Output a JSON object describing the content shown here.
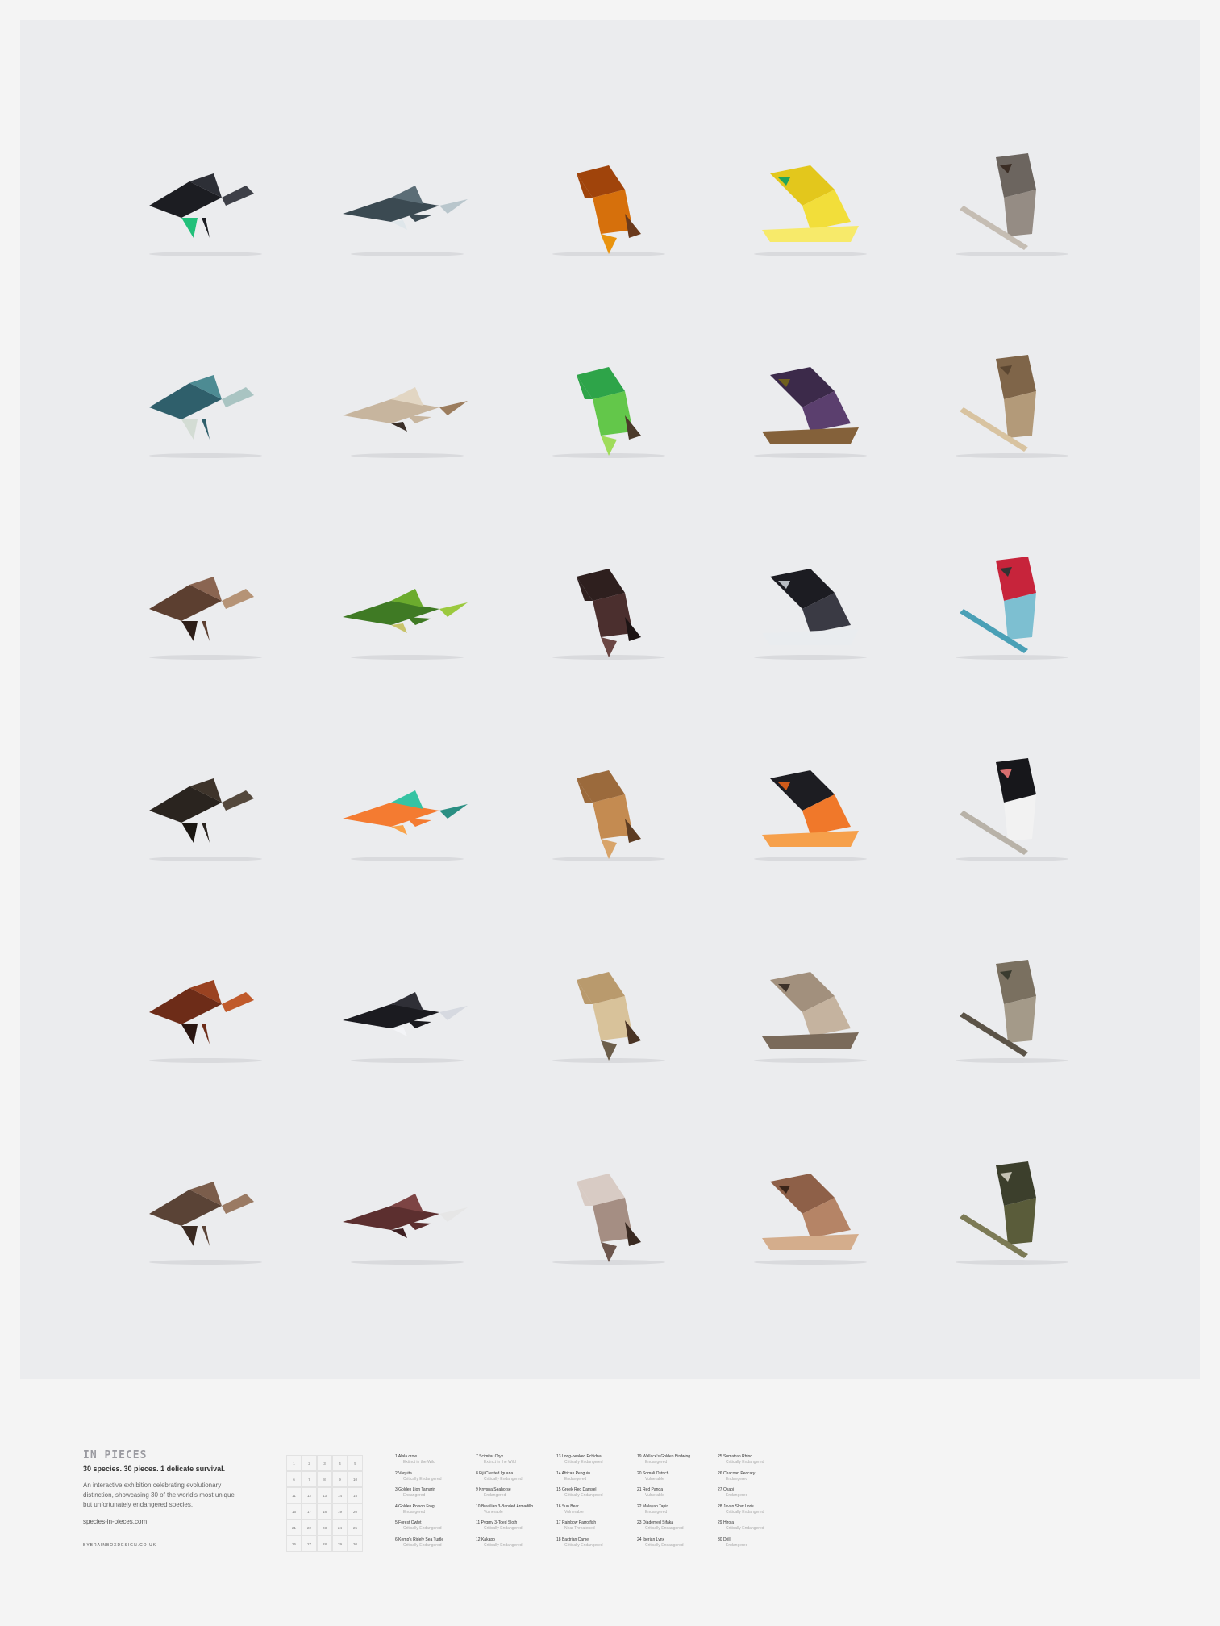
{
  "colors": {
    "canvas": "#ebecee",
    "page": "#f4f4f4",
    "accent": "#9a9aa0"
  },
  "animals": [
    {
      "icon": "crow-icon",
      "colors": [
        "#1c1d22",
        "#2d2f36",
        "#3e4048",
        "#22c07a"
      ]
    },
    {
      "icon": "vaquita-icon",
      "colors": [
        "#3b4a52",
        "#5b6d76",
        "#b9c6cc",
        "#dfe6ea"
      ]
    },
    {
      "icon": "golden-lion-tamarin-icon",
      "colors": [
        "#a0440b",
        "#d6700c",
        "#e9930e",
        "#6b3a1c"
      ]
    },
    {
      "icon": "golden-poison-frog-icon",
      "colors": [
        "#e3c71c",
        "#f2de3a",
        "#f7ea6a",
        "#23a45b"
      ]
    },
    {
      "icon": "forest-owlet-icon",
      "colors": [
        "#6c655f",
        "#958c84",
        "#c5bdb3",
        "#3b2d24"
      ]
    },
    {
      "icon": "kemps-ridley-sea-turtle-icon",
      "colors": [
        "#2f5f6b",
        "#4d8b93",
        "#a9c4c2",
        "#d3dcd4"
      ]
    },
    {
      "icon": "addax-icon",
      "colors": [
        "#c7b59e",
        "#e2d6c3",
        "#9c7d5e",
        "#3a2f29"
      ]
    },
    {
      "icon": "fiji-crested-iguana-icon",
      "colors": [
        "#2ea449",
        "#63c74a",
        "#9fdc5a",
        "#4b3a2a"
      ]
    },
    {
      "icon": "knysna-seahorse-icon",
      "colors": [
        "#3c2a4a",
        "#5b3f6e",
        "#84613a",
        "#6f5f1e"
      ]
    },
    {
      "icon": "brazilian-3-banded-armadillo-icon",
      "colors": [
        "#7f6549",
        "#b39a79",
        "#d8c3a0",
        "#5b4631"
      ]
    },
    {
      "icon": "pygmy-3-toed-sloth-icon",
      "colors": [
        "#5c3f30",
        "#8a6551",
        "#b59376",
        "#2d1e18"
      ]
    },
    {
      "icon": "kakapo-icon",
      "colors": [
        "#3f7a24",
        "#6bab2d",
        "#9bc93e",
        "#c8c36a"
      ]
    },
    {
      "icon": "long-beaked-echidna-icon",
      "colors": [
        "#2e1f1e",
        "#4b2f2e",
        "#6b4744",
        "#1d1414"
      ]
    },
    {
      "icon": "african-penguin-icon",
      "colors": [
        "#1c1c22",
        "#3a3a44",
        "#e9ecef",
        "#b8bcc2"
      ]
    },
    {
      "icon": "greek-red-damsel-icon",
      "colors": [
        "#c7243b",
        "#7dbfd1",
        "#4aa0b6",
        "#333"
      ]
    },
    {
      "icon": "sun-bear-icon",
      "colors": [
        "#2a241f",
        "#3e342b",
        "#54483c",
        "#1a1612"
      ]
    },
    {
      "icon": "rainbow-parrotfish-icon",
      "colors": [
        "#f47b31",
        "#35c3a3",
        "#2a8f83",
        "#f9a34a"
      ]
    },
    {
      "icon": "bactrian-camel-icon",
      "colors": [
        "#9b6a3c",
        "#c48b51",
        "#d8a46a",
        "#5d3c22"
      ]
    },
    {
      "icon": "wallaces-golden-birdwing-icon",
      "colors": [
        "#1d1d22",
        "#f0782a",
        "#f6a04b",
        "#cf5b1a"
      ]
    },
    {
      "icon": "somali-ostrich-icon",
      "colors": [
        "#17171b",
        "#f2f2f2",
        "#b8b2a8",
        "#d86f6f"
      ]
    },
    {
      "icon": "red-panda-icon",
      "colors": [
        "#6d2c18",
        "#9a4221",
        "#c05a2b",
        "#2a1611"
      ]
    },
    {
      "icon": "malayan-tapir-icon",
      "colors": [
        "#1b1b20",
        "#2f2f36",
        "#d6d9e0",
        "#f3f4f7"
      ]
    },
    {
      "icon": "diademed-sifaka-icon",
      "colors": [
        "#b99a6d",
        "#d8c29a",
        "#6c5e4b",
        "#4a3425"
      ]
    },
    {
      "icon": "iberian-lynx-icon",
      "colors": [
        "#a2907d",
        "#c5b39f",
        "#7a6a5a",
        "#3d322a"
      ]
    },
    {
      "icon": "sumatran-rhino-icon",
      "colors": [
        "#7a7060",
        "#a49a89",
        "#5b5347",
        "#3a3b2f"
      ]
    },
    {
      "icon": "chacoan-peccary-icon",
      "colors": [
        "#5a4336",
        "#7b5d4b",
        "#9a7a63",
        "#3a2a22"
      ]
    },
    {
      "icon": "okapi-icon",
      "colors": [
        "#5c2f2f",
        "#7d4444",
        "#e6e6e6",
        "#3d1f21"
      ]
    },
    {
      "icon": "javan-slow-loris-icon",
      "colors": [
        "#d8cbc4",
        "#a58e83",
        "#6d574e",
        "#3a2a22"
      ]
    },
    {
      "icon": "hirola-icon",
      "colors": [
        "#8e6048",
        "#b58466",
        "#d4ad8c",
        "#3a2419"
      ]
    },
    {
      "icon": "drill-icon",
      "colors": [
        "#3c3f2c",
        "#5a5c3a",
        "#7c7a55",
        "#c5c3b5"
      ]
    }
  ],
  "footer": {
    "title": "IN PIECES",
    "tagline": "30 species. 30 pieces. 1 delicate survival.",
    "description": "An interactive exhibition celebrating evolutionary distinction, showcasing 30 of the world's most unique but unfortunately endangered species.",
    "url": "species-in-pieces.com",
    "credit": "BYBRAINBOXDESIGN.CO.UK",
    "numbers": [
      "1",
      "2",
      "3",
      "4",
      "5",
      "6",
      "7",
      "8",
      "9",
      "10",
      "11",
      "12",
      "13",
      "14",
      "15",
      "16",
      "17",
      "18",
      "19",
      "20",
      "21",
      "22",
      "23",
      "24",
      "25",
      "26",
      "27",
      "28",
      "29",
      "30"
    ],
    "species": [
      {
        "num": "1",
        "name": "Alala crow",
        "status": "Extinct in the Wild"
      },
      {
        "num": "2",
        "name": "Vaquita",
        "status": "Critically Endangered"
      },
      {
        "num": "3",
        "name": "Golden Lion Tamarin",
        "status": "Endangered"
      },
      {
        "num": "4",
        "name": "Golden Poison Frog",
        "status": "Endangered"
      },
      {
        "num": "5",
        "name": "Forest Owlet",
        "status": "Critically Endangered"
      },
      {
        "num": "6",
        "name": "Kemp's Ridely Sea Turtle",
        "status": "Critically Endangered"
      },
      {
        "num": "7",
        "name": "Scimitar Oryx",
        "status": "Extinct in the Wild"
      },
      {
        "num": "8",
        "name": "Fiji Crested Iguana",
        "status": "Critically Endangered"
      },
      {
        "num": "9",
        "name": "Knysna Seahorse",
        "status": "Endangered"
      },
      {
        "num": "10",
        "name": "Brazilian 3-Banded Armadillo",
        "status": "Vulnerable"
      },
      {
        "num": "11",
        "name": "Pygmy 3-Toed Sloth",
        "status": "Critically Endangered"
      },
      {
        "num": "12",
        "name": "Kakapo",
        "status": "Critically Endangered"
      },
      {
        "num": "13",
        "name": "Long-beaked Echidna",
        "status": "Critically Endangered"
      },
      {
        "num": "14",
        "name": "African Penguin",
        "status": "Endangered"
      },
      {
        "num": "15",
        "name": "Greek Red Damsel",
        "status": "Critically Endangered"
      },
      {
        "num": "16",
        "name": "Sun Bear",
        "status": "Vulnerable"
      },
      {
        "num": "17",
        "name": "Rainbow Parrotfish",
        "status": "Near Threatened"
      },
      {
        "num": "18",
        "name": "Bactrian Camel",
        "status": "Critically Endangered"
      },
      {
        "num": "19",
        "name": "Wallace's Golden Birdwing",
        "status": "Endangered"
      },
      {
        "num": "20",
        "name": "Somali Ostrich",
        "status": "Vulnerable"
      },
      {
        "num": "21",
        "name": "Red Panda",
        "status": "Vulnerable"
      },
      {
        "num": "22",
        "name": "Malayan Tapir",
        "status": "Endangered"
      },
      {
        "num": "23",
        "name": "Diademed Sifaka",
        "status": "Critically Endangered"
      },
      {
        "num": "24",
        "name": "Iberian Lynx",
        "status": "Critically Endangered"
      },
      {
        "num": "25",
        "name": "Sumatran Rhino",
        "status": "Critically Endangered"
      },
      {
        "num": "26",
        "name": "Chacoan Peccary",
        "status": "Endangered"
      },
      {
        "num": "27",
        "name": "Okapi",
        "status": "Endangered"
      },
      {
        "num": "28",
        "name": "Javan Slow Loris",
        "status": "Critically Endangered"
      },
      {
        "num": "29",
        "name": "Hirola",
        "status": "Critically Endangered"
      },
      {
        "num": "30",
        "name": "Drill",
        "status": "Endangered"
      }
    ]
  }
}
